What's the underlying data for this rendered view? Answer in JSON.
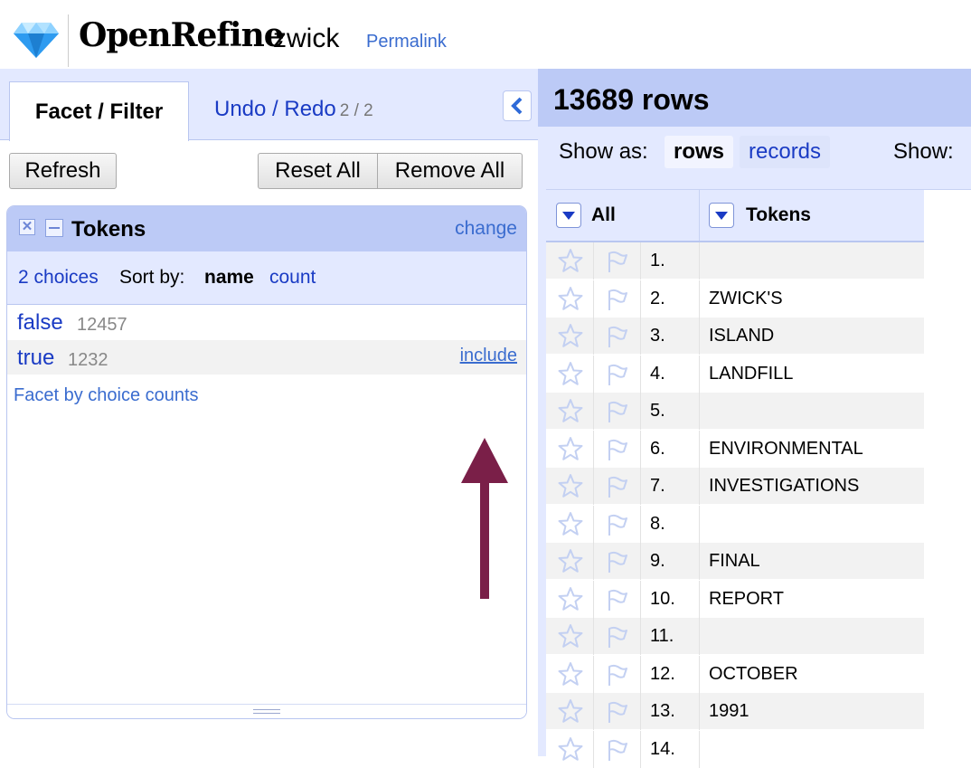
{
  "header": {
    "app_name": "OpenRefine",
    "project_name": "zwick",
    "permalink": "Permalink"
  },
  "left_panel": {
    "tabs": [
      {
        "label": "Facet / Filter",
        "active": true
      },
      {
        "label": "Undo / Redo",
        "count": "2 / 2",
        "active": false
      }
    ],
    "buttons": {
      "refresh": "Refresh",
      "reset_all": "Reset All",
      "remove_all": "Remove All"
    },
    "facet": {
      "title": "Tokens",
      "change_label": "change",
      "choice_count": "2 choices",
      "sort_by_label": "Sort by:",
      "sort_name": "name",
      "sort_count": "count",
      "choices": [
        {
          "label": "false",
          "count": "12457"
        },
        {
          "label": "true",
          "count": "1232",
          "action": "include"
        }
      ],
      "facet_by_counts": "Facet by choice counts"
    },
    "annotation": {
      "color": "#7a1f48",
      "shape": "up-arrow"
    }
  },
  "right_panel": {
    "row_count": "13689 rows",
    "show_as_label": "Show as:",
    "show_rows": "rows",
    "show_records": "records",
    "show_label": "Show:",
    "columns": [
      "All",
      "Tokens"
    ],
    "rows": [
      {
        "num": "1.",
        "token": ""
      },
      {
        "num": "2.",
        "token": "ZWICK'S"
      },
      {
        "num": "3.",
        "token": "ISLAND"
      },
      {
        "num": "4.",
        "token": "LANDFILL"
      },
      {
        "num": "5.",
        "token": ""
      },
      {
        "num": "6.",
        "token": "ENVIRONMENTAL"
      },
      {
        "num": "7.",
        "token": "INVESTIGATIONS"
      },
      {
        "num": "8.",
        "token": ""
      },
      {
        "num": "9.",
        "token": "FINAL"
      },
      {
        "num": "10.",
        "token": "REPORT"
      },
      {
        "num": "11.",
        "token": ""
      },
      {
        "num": "12.",
        "token": "OCTOBER"
      },
      {
        "num": "13.",
        "token": "1991"
      },
      {
        "num": "14.",
        "token": ""
      }
    ]
  },
  "colors": {
    "link": "#1a3bc4",
    "light_link": "#3a6ccf",
    "panel_blue": "#bccaf6",
    "light_blue": "#e3e9ff",
    "gem": "#2e9bf0"
  }
}
